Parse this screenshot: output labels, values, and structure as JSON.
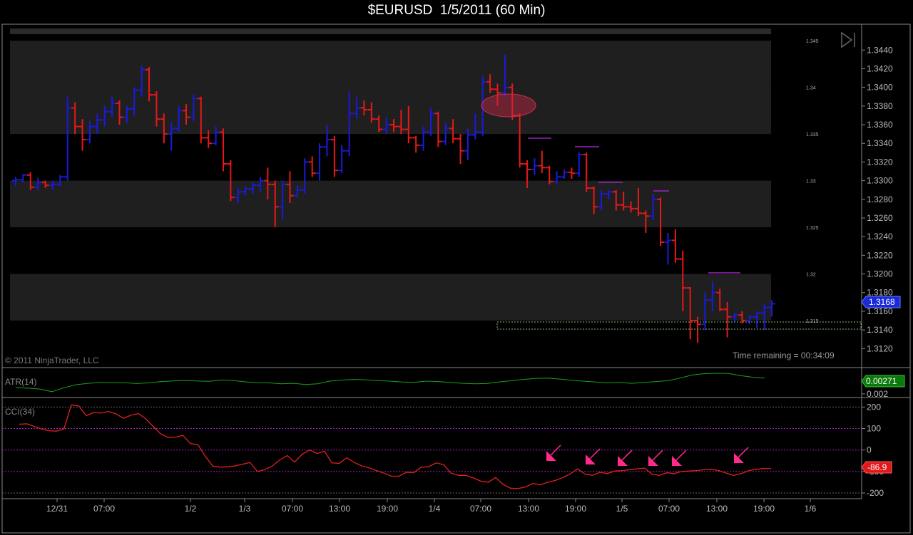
{
  "window": {
    "title": "$EURUSD  1/5/2011 (60 Min)"
  },
  "copyright": "© 2011 NinjaTrader, LLC",
  "time_remaining": "Time remaining = 00:34:09",
  "icons": {
    "nav": "skip-to-end-icon"
  },
  "colors": {
    "up_bar": "#1a1adc",
    "down_bar": "#e81818",
    "zone": "#1f1f1f",
    "atr_line": "#1aa01a",
    "cci_line": "#e02020",
    "arrow": "#ff2a8a",
    "reference": "#a020c0",
    "price_label": "#1a2ad8",
    "atr_label": "#0a7a0a",
    "cci_label": "#e01818"
  },
  "chart_data": [
    {
      "type": "ohlc",
      "title": "$EURUSD  1/5/2011 (60 Min)",
      "x_ticks": [
        "12/31",
        "07:00",
        "1/2",
        "1/3",
        "07:00",
        "13:00",
        "19:00",
        "1/4",
        "07:00",
        "13:00",
        "19:00",
        "1/5",
        "07:00",
        "13:00",
        "19:00",
        "1/6"
      ],
      "y_ticks": [
        "1.3440",
        "1.3420",
        "1.3400",
        "1.3380",
        "1.3360",
        "1.3340",
        "1.3320",
        "1.3300",
        "1.3280",
        "1.3260",
        "1.3240",
        "1.3220",
        "1.3200",
        "1.3180",
        "1.3160",
        "1.3140",
        "1.3120"
      ],
      "ylim": [
        1.3108,
        1.3457
      ],
      "zone_labels": [
        "1.345",
        "1.34",
        "1.335",
        "1.33",
        "1.325",
        "1.32",
        "1.315"
      ],
      "zones": [
        [
          1.34,
          1.345
        ],
        [
          1.335,
          1.34
        ],
        [
          1.325,
          1.33
        ],
        [
          1.315,
          1.32
        ]
      ],
      "last_price": "1.3168",
      "series": [
        {
          "bars": [
            [
              1.33,
              1.3304,
              1.3294,
              1.3301
            ],
            [
              1.3301,
              1.3307,
              1.3298,
              1.3306
            ],
            [
              1.3306,
              1.3309,
              1.329,
              1.3293
            ],
            [
              1.3293,
              1.3303,
              1.329,
              1.3298
            ],
            [
              1.3298,
              1.33,
              1.3292,
              1.3295
            ],
            [
              1.3295,
              1.33,
              1.329,
              1.3296
            ],
            [
              1.3296,
              1.3306,
              1.3294,
              1.3304
            ],
            [
              1.3304,
              1.339,
              1.33,
              1.3378
            ],
            [
              1.3378,
              1.3384,
              1.335,
              1.3358
            ],
            [
              1.3358,
              1.3366,
              1.3332,
              1.3344
            ],
            [
              1.3344,
              1.3364,
              1.334,
              1.3358
            ],
            [
              1.3358,
              1.3372,
              1.335,
              1.3365
            ],
            [
              1.3365,
              1.338,
              1.3358,
              1.3374
            ],
            [
              1.3374,
              1.339,
              1.3368,
              1.3383
            ],
            [
              1.3383,
              1.3386,
              1.336,
              1.3368
            ],
            [
              1.3368,
              1.338,
              1.3362,
              1.3377
            ],
            [
              1.3377,
              1.34,
              1.337,
              1.3397
            ],
            [
              1.3397,
              1.3423,
              1.339,
              1.3419
            ],
            [
              1.3419,
              1.3422,
              1.3385,
              1.3392
            ],
            [
              1.3392,
              1.3396,
              1.3358,
              1.3366
            ],
            [
              1.3366,
              1.3372,
              1.334,
              1.335
            ],
            [
              1.335,
              1.3362,
              1.3332,
              1.3356
            ],
            [
              1.3356,
              1.338,
              1.3352,
              1.3375
            ],
            [
              1.3375,
              1.3382,
              1.336,
              1.3368
            ],
            [
              1.3368,
              1.3392,
              1.3364,
              1.3388
            ],
            [
              1.3388,
              1.339,
              1.334,
              1.3346
            ],
            [
              1.3346,
              1.3354,
              1.3335,
              1.334
            ],
            [
              1.334,
              1.3358,
              1.3338,
              1.3352
            ],
            [
              1.3352,
              1.3356,
              1.331,
              1.3318
            ],
            [
              1.3318,
              1.3322,
              1.3278,
              1.3282
            ],
            [
              1.3282,
              1.3292,
              1.3276,
              1.3288
            ],
            [
              1.3288,
              1.3294,
              1.3284,
              1.3291
            ],
            [
              1.3291,
              1.3298,
              1.3286,
              1.3295
            ],
            [
              1.3295,
              1.3304,
              1.3288,
              1.33
            ],
            [
              1.33,
              1.3314,
              1.328,
              1.3296
            ],
            [
              1.3296,
              1.33,
              1.325,
              1.3272
            ],
            [
              1.3272,
              1.33,
              1.3258,
              1.3296
            ],
            [
              1.3296,
              1.331,
              1.3276,
              1.3284
            ],
            [
              1.3284,
              1.3295,
              1.3282,
              1.329
            ],
            [
              1.329,
              1.3324,
              1.3286,
              1.332
            ],
            [
              1.332,
              1.3326,
              1.3304,
              1.3308
            ],
            [
              1.3308,
              1.334,
              1.33,
              1.3336
            ],
            [
              1.3336,
              1.336,
              1.3326,
              1.3344
            ],
            [
              1.3344,
              1.3348,
              1.3304,
              1.3311
            ],
            [
              1.3311,
              1.3338,
              1.3308,
              1.3332
            ],
            [
              1.3332,
              1.3396,
              1.3326,
              1.3372
            ],
            [
              1.3372,
              1.339,
              1.3366,
              1.3378
            ],
            [
              1.3378,
              1.3386,
              1.337,
              1.3376
            ],
            [
              1.3376,
              1.3384,
              1.3362,
              1.3366
            ],
            [
              1.3366,
              1.337,
              1.3352,
              1.3355
            ],
            [
              1.3355,
              1.3368,
              1.335,
              1.336
            ],
            [
              1.336,
              1.3366,
              1.3352,
              1.3358
            ],
            [
              1.3358,
              1.3376,
              1.335,
              1.3355
            ],
            [
              1.3355,
              1.338,
              1.334,
              1.3346
            ],
            [
              1.3346,
              1.3348,
              1.333,
              1.3338
            ],
            [
              1.3338,
              1.3358,
              1.3332,
              1.3352
            ],
            [
              1.3352,
              1.3378,
              1.3348,
              1.3372
            ],
            [
              1.3372,
              1.3374,
              1.3336,
              1.3342
            ],
            [
              1.3342,
              1.3362,
              1.3338,
              1.3356
            ],
            [
              1.3356,
              1.3366,
              1.334,
              1.3345
            ],
            [
              1.3345,
              1.335,
              1.3318,
              1.3332
            ],
            [
              1.3332,
              1.3356,
              1.3322,
              1.3349
            ],
            [
              1.3349,
              1.3372,
              1.3344,
              1.3352
            ],
            [
              1.3352,
              1.3412,
              1.3348,
              1.3406
            ],
            [
              1.3406,
              1.3414,
              1.3394,
              1.3398
            ],
            [
              1.3398,
              1.3404,
              1.338,
              1.3394
            ],
            [
              1.3394,
              1.3435,
              1.339,
              1.34
            ],
            [
              1.34,
              1.3404,
              1.3365,
              1.337
            ],
            [
              1.337,
              1.3372,
              1.3314,
              1.3318
            ],
            [
              1.3318,
              1.3322,
              1.3292,
              1.3312
            ],
            [
              1.3312,
              1.3324,
              1.3306,
              1.3316
            ],
            [
              1.3316,
              1.3332,
              1.3308,
              1.3314
            ],
            [
              1.3314,
              1.3316,
              1.3296,
              1.3299
            ],
            [
              1.3299,
              1.331,
              1.3296,
              1.3304
            ],
            [
              1.3304,
              1.3312,
              1.3302,
              1.3309
            ],
            [
              1.3309,
              1.3314,
              1.3302,
              1.3308
            ],
            [
              1.3308,
              1.333,
              1.3304,
              1.3328
            ],
            [
              1.3328,
              1.333,
              1.3288,
              1.3292
            ],
            [
              1.3292,
              1.3294,
              1.3264,
              1.3272
            ],
            [
              1.3272,
              1.329,
              1.3268,
              1.3286
            ],
            [
              1.3286,
              1.329,
              1.328,
              1.3288
            ],
            [
              1.3288,
              1.329,
              1.3268,
              1.3274
            ],
            [
              1.3274,
              1.3288,
              1.3268,
              1.3272
            ],
            [
              1.3272,
              1.3278,
              1.3266,
              1.327
            ],
            [
              1.327,
              1.3292,
              1.3262,
              1.3265
            ],
            [
              1.3265,
              1.3268,
              1.3244,
              1.3262
            ],
            [
              1.3262,
              1.3286,
              1.3258,
              1.328
            ],
            [
              1.328,
              1.3282,
              1.323,
              1.3234
            ],
            [
              1.3234,
              1.3244,
              1.321,
              1.3236
            ],
            [
              1.3236,
              1.3248,
              1.3212,
              1.3216
            ],
            [
              1.3216,
              1.3225,
              1.316,
              1.3185
            ],
            [
              1.3185,
              1.3186,
              1.313,
              1.315
            ],
            [
              1.315,
              1.3154,
              1.3126,
              1.3146
            ],
            [
              1.3146,
              1.318,
              1.314,
              1.3172
            ],
            [
              1.3172,
              1.3192,
              1.316,
              1.318
            ],
            [
              1.318,
              1.3184,
              1.316,
              1.3162
            ],
            [
              1.3162,
              1.317,
              1.3132,
              1.3154
            ],
            [
              1.3154,
              1.3158,
              1.3148,
              1.3156
            ],
            [
              1.3156,
              1.316,
              1.3147,
              1.315
            ],
            [
              1.315,
              1.3156,
              1.3146,
              1.3154
            ],
            [
              1.3154,
              1.316,
              1.3142,
              1.3158
            ],
            [
              1.3158,
              1.3168,
              1.314,
              1.3164
            ],
            [
              1.3164,
              1.3172,
              1.3154,
              1.3168
            ]
          ]
        }
      ]
    },
    {
      "type": "line",
      "indicator": "ATR(14)",
      "y_ticks": [
        "0.002"
      ],
      "last_value": "0.00271",
      "series": [
        {
          "values": [
            0.00228,
            0.00226,
            0.00222,
            0.0021,
            0.00228,
            0.00242,
            0.00248,
            0.00252,
            0.00251,
            0.00251,
            0.00247,
            0.0025,
            0.00256,
            0.00259,
            0.00261,
            0.00259,
            0.00257,
            0.00263,
            0.00261,
            0.00255,
            0.00251,
            0.0025,
            0.00246,
            0.00248,
            0.00243,
            0.00246,
            0.00258,
            0.00263,
            0.00266,
            0.00264,
            0.0026,
            0.00258,
            0.00254,
            0.00253,
            0.00258,
            0.00256,
            0.00252,
            0.00248,
            0.00246,
            0.00247,
            0.00254,
            0.0026,
            0.00266,
            0.0027,
            0.00272,
            0.00268,
            0.00262,
            0.00258,
            0.00254,
            0.0025,
            0.00252,
            0.00248,
            0.00252,
            0.00256,
            0.0026,
            0.00272,
            0.00286,
            0.00292,
            0.00294,
            0.00293,
            0.00283,
            0.00276,
            0.00272
          ]
        }
      ]
    },
    {
      "type": "line",
      "indicator": "CCI(34)",
      "y_ticks": [
        "200",
        "100",
        "0",
        "-100",
        "-200"
      ],
      "ylim": [
        -220,
        218
      ],
      "last_value": "-86.9",
      "series": [
        {
          "values": [
            120,
            122,
            110,
            98,
            90,
            88,
            98,
            210,
            205,
            160,
            175,
            172,
            180,
            168,
            148,
            162,
            170,
            145,
            110,
            75,
            58,
            60,
            68,
            30,
            25,
            -30,
            -75,
            -80,
            -78,
            -74,
            -66,
            -58,
            -100,
            -92,
            -74,
            -46,
            -26,
            -56,
            -20,
            0,
            -16,
            -6,
            -60,
            -62,
            -36,
            -58,
            -74,
            -83,
            -96,
            -108,
            -122,
            -122,
            -104,
            -106,
            -80,
            -78,
            -60,
            -68,
            -108,
            -118,
            -118,
            -130,
            -145,
            -150,
            -128,
            -160,
            -178,
            -180,
            -172,
            -156,
            -162,
            -150,
            -142,
            -128,
            -112,
            -88,
            -112,
            -118,
            -104,
            -110,
            -98,
            -96,
            -92,
            -88,
            -84,
            -112,
            -118,
            -106,
            -110,
            -100,
            -98,
            -96,
            -92,
            -90,
            -96,
            -108,
            -118,
            -110,
            -96,
            -90,
            -86,
            -86.9
          ]
        }
      ],
      "arrows": 6
    }
  ]
}
